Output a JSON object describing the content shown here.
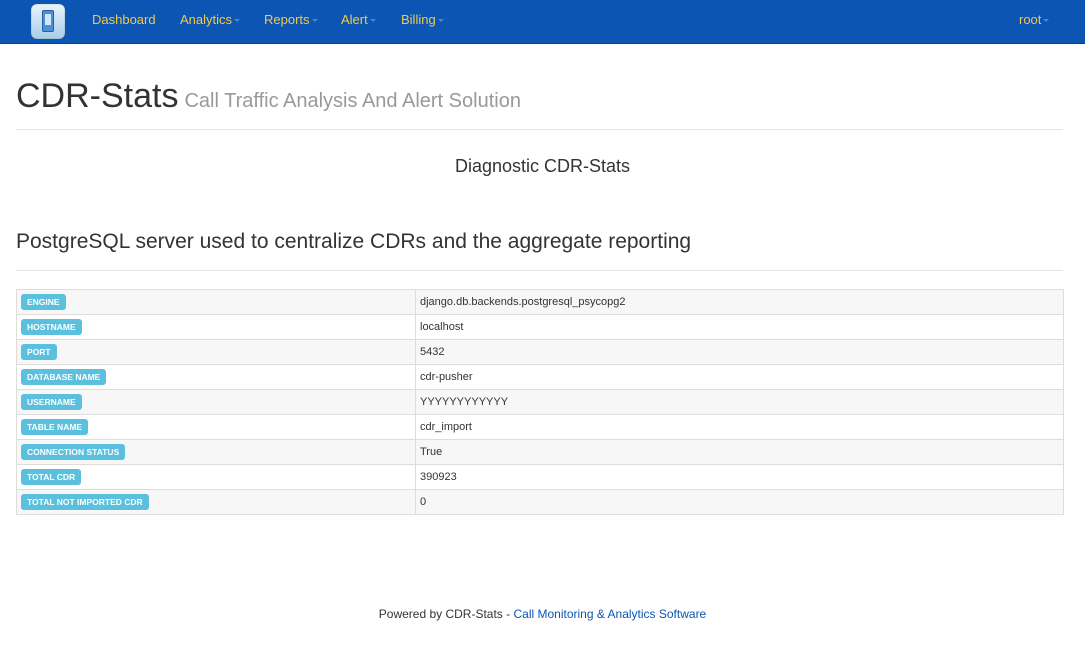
{
  "navbar": {
    "logo_icon": "phone-logo-icon",
    "items": [
      {
        "label": "Dashboard",
        "dropdown": false
      },
      {
        "label": "Analytics",
        "dropdown": true
      },
      {
        "label": "Reports",
        "dropdown": true
      },
      {
        "label": "Alert",
        "dropdown": true
      },
      {
        "label": "Billing",
        "dropdown": true
      }
    ],
    "user": "root",
    "background_color": "#0c55b3",
    "link_color": "#f2c94c"
  },
  "header": {
    "title": "CDR-Stats",
    "subtitle": "Call Traffic Analysis And Alert Solution"
  },
  "diagnostic_heading": "Diagnostic CDR-Stats",
  "section_title": "PostgreSQL server used to centralize CDRs and the aggregate reporting",
  "table": {
    "rows": [
      {
        "key": "ENGINE",
        "value": "django.db.backends.postgresql_psycopg2"
      },
      {
        "key": "HOSTNAME",
        "value": "localhost"
      },
      {
        "key": "PORT",
        "value": "5432"
      },
      {
        "key": "DATABASE NAME",
        "value": "cdr-pusher"
      },
      {
        "key": "USERNAME",
        "value": "YYYYYYYYYYYY"
      },
      {
        "key": "TABLE NAME",
        "value": "cdr_import"
      },
      {
        "key": "CONNECTION STATUS",
        "value": "True"
      },
      {
        "key": "TOTAL CDR",
        "value": "390923"
      },
      {
        "key": "TOTAL NOT IMPORTED CDR",
        "value": "0"
      }
    ],
    "badge_color": "#5bc0de"
  },
  "footer": {
    "prefix": "Powered by CDR-Stats - ",
    "link_text": "Call Monitoring & Analytics Software"
  }
}
